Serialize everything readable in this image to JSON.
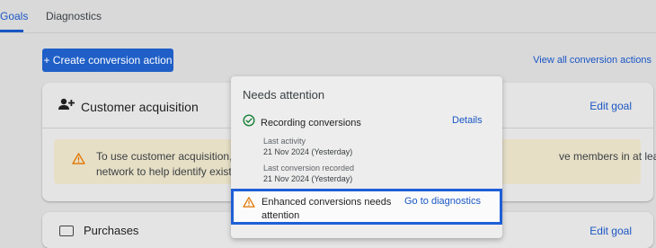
{
  "tabs": [
    {
      "label": "Goals"
    },
    {
      "label": "Diagnostics"
    }
  ],
  "toolbar": {
    "create_label": "+ Create conversion action",
    "view_all_label": "View all conversion actions"
  },
  "card": {
    "title": "Customer acquisition",
    "edit_label": "Edit goal",
    "icon": "person-add-icon",
    "banner": {
      "icon": "warning-icon",
      "line1_start": "To use customer acquisition, yo",
      "line1_end": "ve members in at least one",
      "line2": "network to help identify existing"
    }
  },
  "card2": {
    "title": "Purchases",
    "edit_label": "Edit goal"
  },
  "popup": {
    "title": "Needs attention",
    "recording": {
      "icon": "check-circle-icon",
      "label": "Recording conversions",
      "details_label": "Details",
      "last_activity_label": "Last activity",
      "last_activity_value": "21 Nov 2024 (Yesterday)",
      "last_conversion_label": "Last conversion recorded",
      "last_conversion_value": "21 Nov 2024 (Yesterday)"
    },
    "enhanced": {
      "icon": "warning-icon",
      "text": "Enhanced conversions needs attention",
      "link_label": "Go to diagnostics"
    }
  },
  "colors": {
    "accent": "#1a56c4",
    "button": "#1f5fc7",
    "highlight_border": "#1f5fd6",
    "warning": "#e37400",
    "success": "#188038"
  }
}
